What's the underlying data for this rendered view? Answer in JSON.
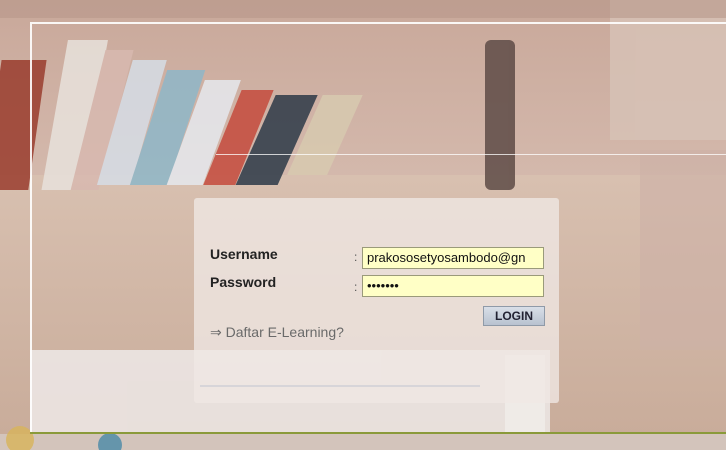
{
  "login": {
    "username_label": "Username",
    "password_label": "Password",
    "colon": ":",
    "username_value": "prakososetyosambodo@gn",
    "password_value": "•••••••",
    "login_button": "LOGIN",
    "register_link": "⇒ Daftar E-Learning?"
  },
  "colors": {
    "field_background": "#ffffc6",
    "button_background": "#c8d0dc"
  }
}
